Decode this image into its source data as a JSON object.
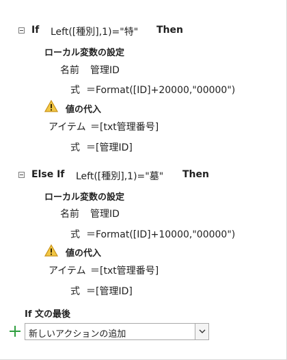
{
  "block1": {
    "if_keyword": "If",
    "condition": "Left([種別],1)=\"特\"",
    "then_keyword": "Then",
    "local_var_title": "ローカル変数の設定",
    "name_label": "名前",
    "name_value": "管理ID",
    "expr_label": "式",
    "expr_value": "＝Format([ID]+20000,\"00000\")",
    "assign_title": "値の代入",
    "item_label": "アイテム",
    "item_value": "＝[txt管理番号]",
    "expr2_label": "式",
    "expr2_value": "＝[管理ID]"
  },
  "block2": {
    "elseif_keyword": "Else If",
    "condition": "Left([種別],1)=\"墓\"",
    "then_keyword": "Then",
    "local_var_title": "ローカル変数の設定",
    "name_label": "名前",
    "name_value": "管理ID",
    "expr_label": "式",
    "expr_value": "＝Format([ID]+10000,\"00000\")",
    "assign_title": "値の代入",
    "item_label": "アイテム",
    "item_value": "＝[txt管理番号]",
    "expr2_label": "式",
    "expr2_value": "＝[管理ID]"
  },
  "end_if_label": "If 文の最後",
  "add_action": {
    "value": "新しいアクションの追加"
  },
  "colors": {
    "warning_fill": "#f2c744",
    "warning_stroke": "#c9931a",
    "plus_green": "#2e9e3e"
  }
}
